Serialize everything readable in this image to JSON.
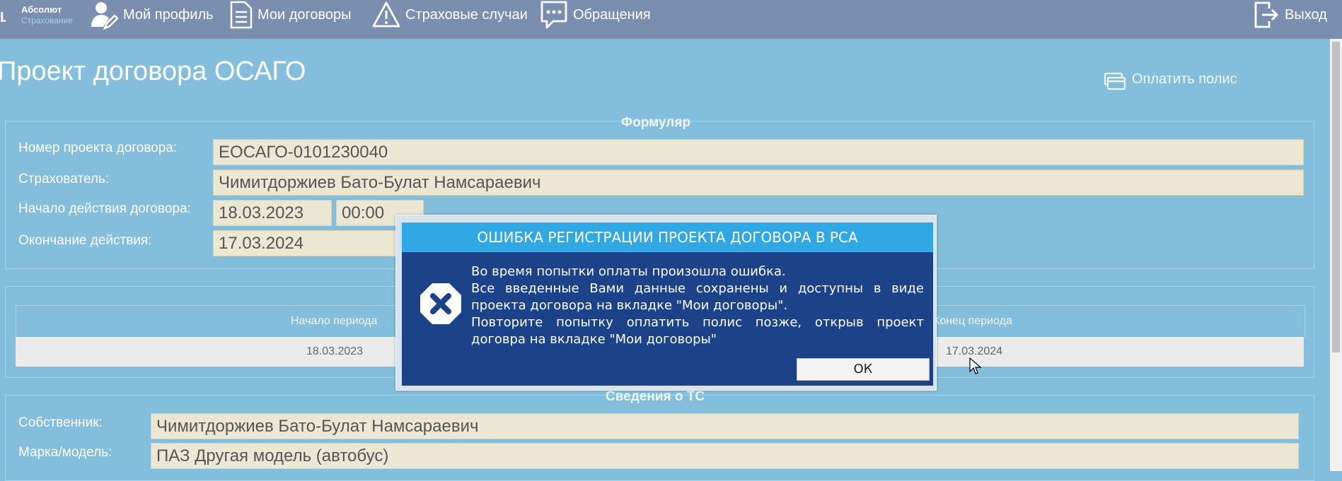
{
  "nav": {
    "logo_line1": "Абсолют",
    "logo_line2": "Страхование",
    "profile": "Мой профиль",
    "contracts": "Мои договоры",
    "claims": "Страховые случаи",
    "appeals": "Обращения",
    "logout": "Выход"
  },
  "page": {
    "title": "Проект договора ОСАГО",
    "pay_button": "Оплатить полис"
  },
  "form": {
    "legend": "Формуляр",
    "number_label": "Номер проекта договора:",
    "number_value": "ЕОСАГО-0101230040",
    "insurer_label": "Страхователь:",
    "insurer_value": "Чимитдоржиев Бато-Булат Намсараевич",
    "start_label": "Начало действия договора:",
    "start_date": "18.03.2023",
    "start_time": "00:00",
    "end_label": "Окончание действия:",
    "end_date": "17.03.2024"
  },
  "periods": {
    "col_start": "Начало периода",
    "col_end": "Конец периода",
    "rows": [
      {
        "start": "18.03.2023",
        "end": "17.03.2024"
      }
    ]
  },
  "vehicle": {
    "legend": "Сведения о ТС",
    "owner_label": "Собственник:",
    "owner_value": "Чимитдоржиев Бато-Булат Намсараевич",
    "model_label": "Марка/модель:",
    "model_value": "ПАЗ Другая модель (автобус)"
  },
  "dialog": {
    "title": "ОШИБКА РЕГИСТРАЦИИ ПРОЕКТА ДОГОВОРА В РСА",
    "line1": "Во время попытки оплаты произошла ошибка.",
    "line2": "Все введенные Вами данные сохранены и доступны в виде проекта договора на вкладке \"Мои договоры\".",
    "line3": "Повторите попытку оплатить полис позже, открыв проект договра на вкладке \"Мои договоры\"",
    "ok": "ОК"
  },
  "icons": {
    "profile": "user-edit-icon",
    "contracts": "document-icon",
    "claims": "warning-icon",
    "appeals": "chat-icon",
    "logout": "exit-icon",
    "pay": "card-icon",
    "error": "error-icon"
  }
}
